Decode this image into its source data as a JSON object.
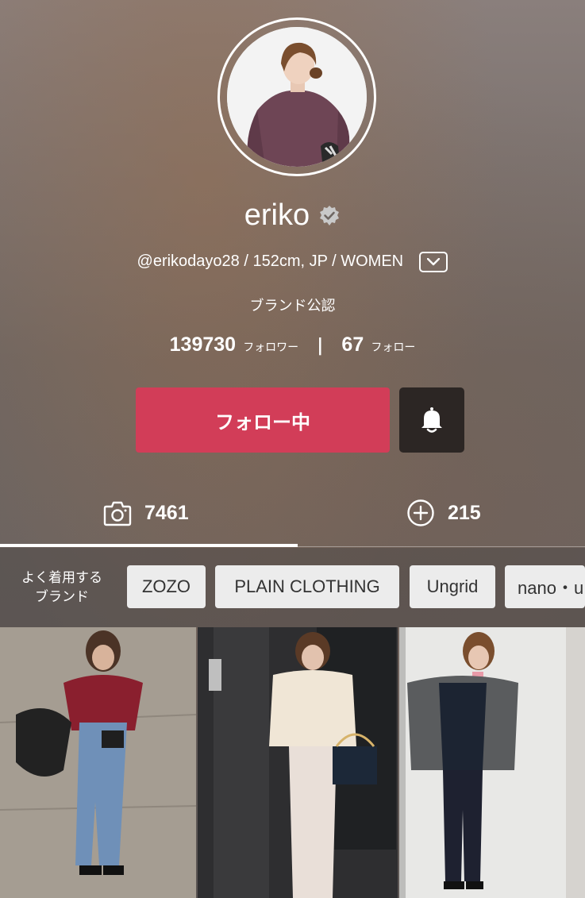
{
  "profile": {
    "name": "eriko",
    "meta": "@erikodayo28 / 152cm, JP / WOMEN",
    "official": "ブランド公認",
    "followers_count": "139730",
    "followers_label": "フォロワー",
    "separator": "|",
    "following_count": "67",
    "following_label": "フォロー"
  },
  "actions": {
    "follow_label": "フォロー中"
  },
  "tabs": [
    {
      "icon": "camera-icon",
      "count": "7461"
    },
    {
      "icon": "plus-circle-icon",
      "count": "215"
    }
  ],
  "brands": {
    "label_line1": "よく着用する",
    "label_line2": "ブランド",
    "items": [
      "ZOZO",
      "PLAIN CLOTHING",
      "Ungrid",
      "nano・u"
    ]
  },
  "colors": {
    "follow_button": "#d23d58",
    "bell_button": "#2c2624",
    "chip_bg": "#ececec"
  }
}
